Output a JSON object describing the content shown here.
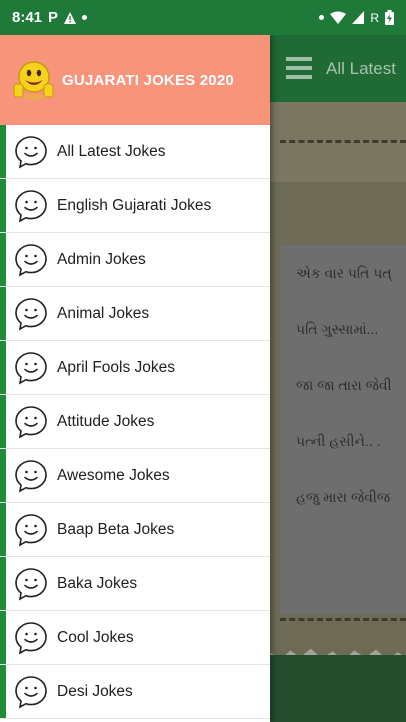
{
  "status_bar": {
    "time": "8:41",
    "left_icons": [
      "p-notification-icon",
      "warning-icon"
    ],
    "right_icons": [
      "dot-icon",
      "wifi-icon",
      "signal-icon",
      "r-roaming-text",
      "battery-charging-icon"
    ],
    "roaming_text": "R"
  },
  "drawer": {
    "header": {
      "title": "GUJARATI JOKES 2020",
      "background": "#f79479"
    },
    "items": [
      {
        "label": "All Latest Jokes",
        "icon": "smiley-bubble-icon"
      },
      {
        "label": "English Gujarati Jokes",
        "icon": "smiley-bubble-icon"
      },
      {
        "label": "Admin Jokes",
        "icon": "smiley-bubble-icon"
      },
      {
        "label": "Animal Jokes",
        "icon": "smiley-bubble-icon"
      },
      {
        "label": "April Fools Jokes",
        "icon": "smiley-bubble-icon"
      },
      {
        "label": "Attitude Jokes",
        "icon": "smiley-bubble-icon"
      },
      {
        "label": "Awesome Jokes",
        "icon": "smiley-bubble-icon"
      },
      {
        "label": "Baap Beta Jokes",
        "icon": "smiley-bubble-icon"
      },
      {
        "label": "Baka Jokes",
        "icon": "smiley-bubble-icon"
      },
      {
        "label": "Cool Jokes",
        "icon": "smiley-bubble-icon"
      },
      {
        "label": "Desi Jokes",
        "icon": "smiley-bubble-icon"
      }
    ]
  },
  "app": {
    "toolbar_title": "All Latest",
    "joke_lines": [
      "એક વાર પતિ પત્",
      "પતિ ગુસ્સામાં...",
      "જા જા તારા જેવી",
      "પત્ની હસીને.. .",
      "હજુ મારા જેવીજ"
    ]
  },
  "colors": {
    "status_bar": "#1f7a3a",
    "accent_green": "#1e8c34",
    "header": "#f79479"
  }
}
